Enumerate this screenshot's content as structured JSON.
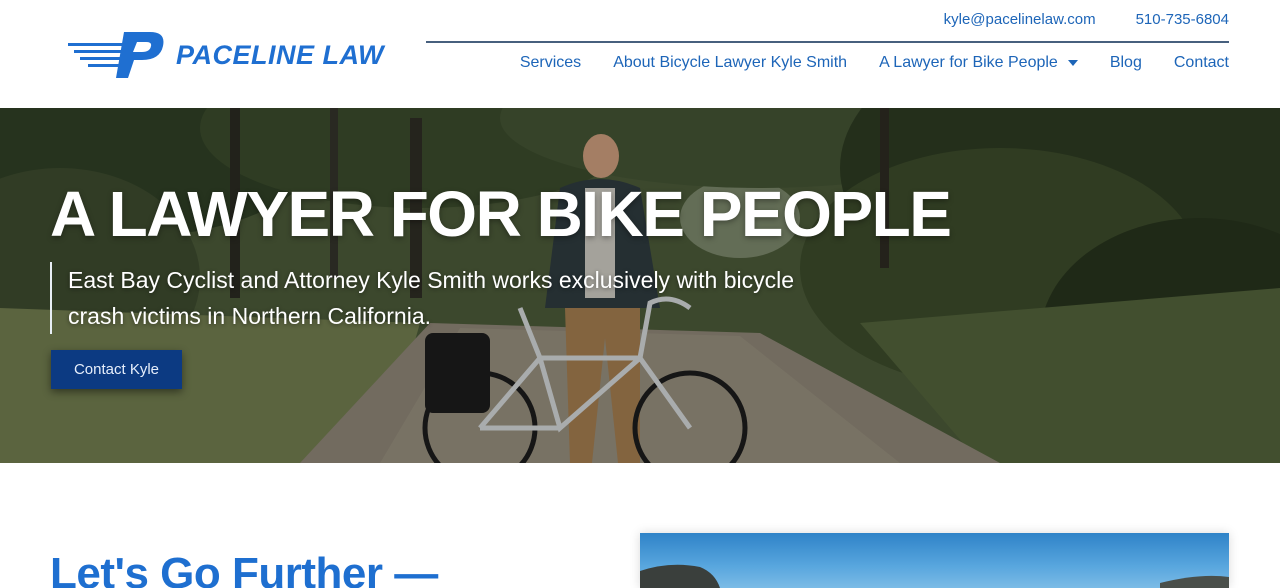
{
  "brand": {
    "name": "PACELINE LAW",
    "logo_icon": "paceline-p-logo-icon",
    "color": "#1f6fd1"
  },
  "contact": {
    "email": "kyle@pacelinelaw.com",
    "phone": "510-735-6804"
  },
  "nav": {
    "items": [
      {
        "label": "Services"
      },
      {
        "label": "About Bicycle Lawyer Kyle Smith"
      },
      {
        "label": "A Lawyer for Bike People",
        "has_dropdown": true
      },
      {
        "label": "Blog"
      },
      {
        "label": "Contact"
      }
    ]
  },
  "hero": {
    "title": "A LAWYER FOR BIKE PEOPLE",
    "subtitle": "East Bay Cyclist and Attorney Kyle Smith works exclusively with bicycle crash victims in Northern California.",
    "cta_label": "Contact Kyle",
    "cta_color": "#0c3a82"
  },
  "section": {
    "heading": "Let's Go Further —"
  },
  "colors": {
    "link": "#1d65b8",
    "accent": "#1e6fd0",
    "header_rule": "#47607e"
  }
}
